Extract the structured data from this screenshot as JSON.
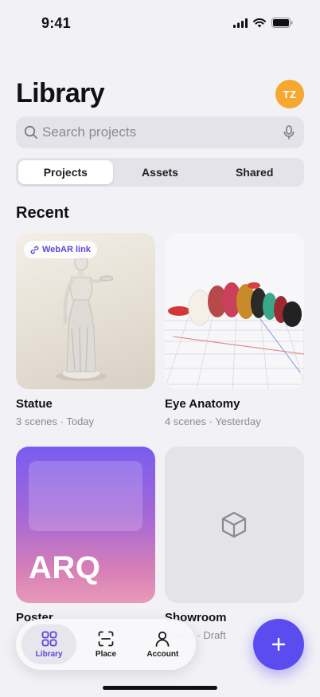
{
  "status_bar": {
    "time": "9:41",
    "icons": [
      "signal-icon",
      "wifi-icon",
      "battery-icon"
    ]
  },
  "header": {
    "title": "Library",
    "avatar_initials": "TZ",
    "avatar_color": "#f5a830"
  },
  "search": {
    "placeholder": "Search projects",
    "value": ""
  },
  "segments": [
    {
      "label": "Projects",
      "active": true
    },
    {
      "label": "Assets",
      "active": false
    },
    {
      "label": "Shared",
      "active": false
    }
  ],
  "section": {
    "title": "Recent"
  },
  "projects": [
    {
      "name": "Statue",
      "meta": "3 scenes · Today",
      "badge": "WebAR link"
    },
    {
      "name": "Eye Anatomy",
      "meta": "4 scenes · Yesterday"
    },
    {
      "name": "Poster",
      "meta": "",
      "poster_text": "ARQ"
    },
    {
      "name": "Showroom",
      "meta": "Scene · Draft"
    }
  ],
  "tabbar": {
    "items": [
      {
        "label": "Library",
        "icon": "grid-icon",
        "active": true
      },
      {
        "label": "Place",
        "icon": "scan-icon",
        "active": false
      },
      {
        "label": "Account",
        "icon": "person-icon",
        "active": false
      }
    ]
  },
  "accent_color": "#5b4cf0"
}
